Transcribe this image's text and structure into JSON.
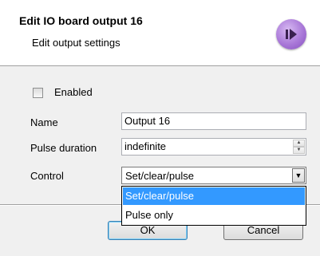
{
  "header": {
    "title": "Edit IO board output 16",
    "subtitle": "Edit output settings",
    "icon": "next-arrow-icon"
  },
  "form": {
    "enabled": {
      "label": "Enabled",
      "checked": false
    },
    "name": {
      "label": "Name",
      "value": "Output 16"
    },
    "pulse_duration": {
      "label": "Pulse duration",
      "value": "indefinite"
    },
    "control": {
      "label": "Control",
      "selected": "Set/clear/pulse",
      "options": [
        "Set/clear/pulse",
        "Pulse only"
      ]
    }
  },
  "buttons": {
    "ok": "OK",
    "cancel": "Cancel"
  },
  "colors": {
    "accent": "#3399ff",
    "header_bg": "#ffffff",
    "panel_bg": "#f0f0f0",
    "icon_purple": "#a978d8"
  }
}
